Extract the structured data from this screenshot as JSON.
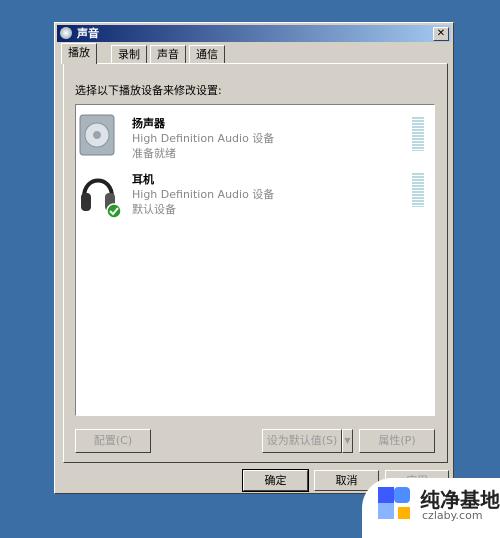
{
  "window": {
    "title": "声音",
    "close": "✕"
  },
  "tabs": [
    {
      "label": "播放"
    },
    {
      "label": "录制"
    },
    {
      "label": "声音"
    },
    {
      "label": "通信"
    }
  ],
  "instruction": "选择以下播放设备来修改设置:",
  "devices": [
    {
      "name": "扬声器",
      "description": "High Definition Audio 设备",
      "status": "准备就绪",
      "icon": "speaker-icon"
    },
    {
      "name": "耳机",
      "description": "High Definition Audio 设备",
      "status": "默认设备",
      "icon": "headphones-icon",
      "default": true
    }
  ],
  "buttons": {
    "configure": "配置(C)",
    "set_default": "设为默认值(S)",
    "properties": "属性(P)",
    "ok": "确定",
    "cancel": "取消",
    "apply": "应用"
  },
  "watermark": {
    "brand": "纯净基地",
    "url": "czlaby.com"
  },
  "colors": {
    "desktop": "#3a6ea5",
    "titlebar": "#0a246a",
    "check": "#2a9a2a"
  }
}
